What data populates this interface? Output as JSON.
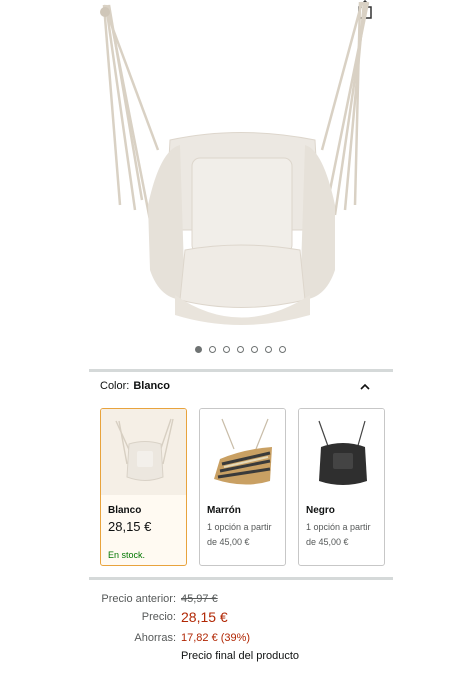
{
  "product": {
    "image_alt": "hamaca-silla-colgante",
    "carousel": {
      "total": 7,
      "active": 0
    }
  },
  "icons": {
    "share": "share-icon",
    "collapse": "chevron-up-icon"
  },
  "color_selector": {
    "label": "Color:",
    "selected": "Blanco",
    "options": [
      {
        "name": "Blanco",
        "price": "28,15 €",
        "stock": "En stock.",
        "selected": true
      },
      {
        "name": "Marrón",
        "opt_line1": "1 opción a partir",
        "opt_line2": "de 45,00 €",
        "selected": false
      },
      {
        "name": "Negro",
        "opt_line1": "1 opción a partir",
        "opt_line2": "de 45,00 €",
        "selected": false
      }
    ]
  },
  "pricing": {
    "previous_label": "Precio anterior:",
    "previous_value": "45,97 €",
    "price_label": "Precio:",
    "price_value": "28,15 €",
    "savings_label": "Ahorras:",
    "savings_value": "17,82 € (39%)",
    "final_note": "Precio final del producto"
  },
  "colors": {
    "accent_selected": "#e8a33d",
    "price_red": "#b12704",
    "stock_green": "#007600"
  }
}
